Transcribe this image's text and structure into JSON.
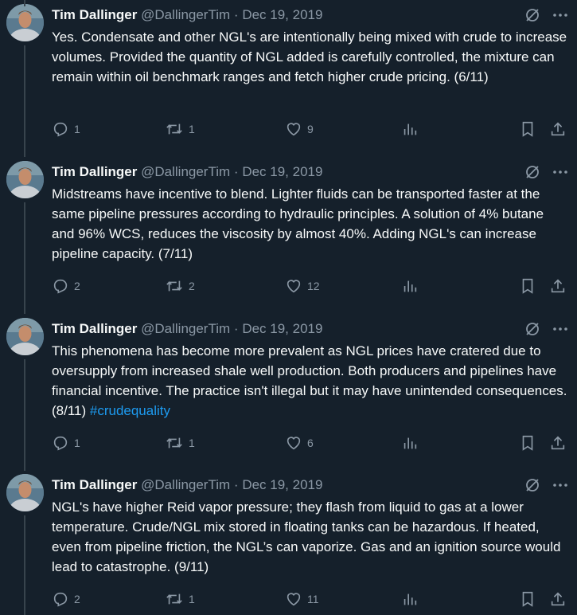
{
  "tweets": [
    {
      "name": "Tim Dallinger",
      "handle": "@DallingerTim",
      "separator": "·",
      "date": "Dec 19, 2019",
      "text": "Yes. Condensate and other NGL's are intentionally being mixed with crude to increase volumes. Provided the quantity of NGL added is carefully controlled, the mixture can remain within oil benchmark ranges and fetch higher crude pricing. (6/11)",
      "hashtag": "",
      "replies": "1",
      "retweets": "1",
      "likes": "9"
    },
    {
      "name": "Tim Dallinger",
      "handle": "@DallingerTim",
      "separator": "·",
      "date": "Dec 19, 2019",
      "text": "Midstreams have incentive to blend.  Lighter fluids can be transported faster at the same pipeline pressures according to hydraulic principles. A solution of 4% butane and 96% WCS, reduces the viscosity by almost 40%. Adding NGL's can increase pipeline capacity. (7/11)",
      "hashtag": "",
      "replies": "2",
      "retweets": "2",
      "likes": "12"
    },
    {
      "name": "Tim Dallinger",
      "handle": "@DallingerTim",
      "separator": "·",
      "date": "Dec 19, 2019",
      "text": "This phenomena has become more prevalent as NGL prices have cratered due to oversupply from increased shale well production. Both producers and pipelines have financial incentive. The practice isn't illegal but it may have unintended consequences. (8/11) ",
      "hashtag": "#crudequality",
      "replies": "1",
      "retweets": "1",
      "likes": "6"
    },
    {
      "name": "Tim Dallinger",
      "handle": "@DallingerTim",
      "separator": "·",
      "date": "Dec 19, 2019",
      "text": "NGL's have higher Reid vapor pressure; they flash from liquid to gas at a lower temperature. Crude/NGL mix stored in floating tanks can be hazardous. If heated, even from pipeline friction, the NGL’s can vaporize. Gas and an ignition source would lead to catastrophe. (9/11)",
      "hashtag": "",
      "replies": "2",
      "retweets": "1",
      "likes": "11"
    }
  ],
  "colors": {
    "background": "#15202b",
    "text": "#f7f9f9",
    "muted": "#8b98a5",
    "accent": "#1d9bf0",
    "thread_line": "#38444d"
  },
  "icons": [
    "avatar",
    "grok-icon",
    "more-icon",
    "reply-icon",
    "retweet-icon",
    "like-icon",
    "views-icon",
    "bookmark-icon",
    "share-icon"
  ]
}
